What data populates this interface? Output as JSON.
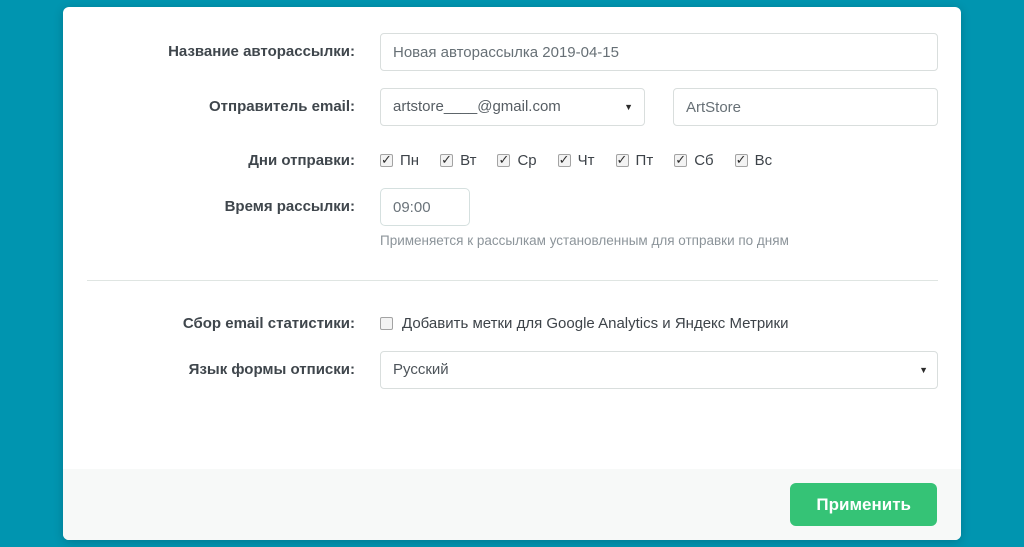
{
  "theme": {
    "page_background": "#0095b0",
    "card_background": "#ffffff",
    "footer_background": "#f7f9f8",
    "accent_green": "#35c376",
    "input_border": "#d9dedd",
    "label_color": "#3f464c"
  },
  "form": {
    "name": {
      "label": "Название авторассылки:",
      "value": "Новая авторассылка 2019-04-15"
    },
    "sender": {
      "label": "Отправитель email:",
      "email_selected": "artstore____@gmail.com",
      "sender_name": "ArtStore",
      "caret_icon": "▼"
    },
    "days": {
      "label": "Дни отправки:",
      "items": [
        {
          "label": "Пн",
          "checked": true
        },
        {
          "label": "Вт",
          "checked": true
        },
        {
          "label": "Ср",
          "checked": true
        },
        {
          "label": "Чт",
          "checked": true
        },
        {
          "label": "Пт",
          "checked": true
        },
        {
          "label": "Сб",
          "checked": true
        },
        {
          "label": "Вс",
          "checked": true
        }
      ]
    },
    "time": {
      "label": "Время рассылки:",
      "value": "09:00",
      "hint": "Применяется к рассылкам установленным для отправки по дням"
    },
    "stats": {
      "label": "Сбор email статистики:",
      "checkbox_label": "Добавить метки для Google Analytics и Яндекс Метрики",
      "checked": false
    },
    "language": {
      "label": "Язык формы отписки:",
      "selected": "Русский",
      "caret_icon": "▼"
    },
    "submit_label": "Применить"
  }
}
